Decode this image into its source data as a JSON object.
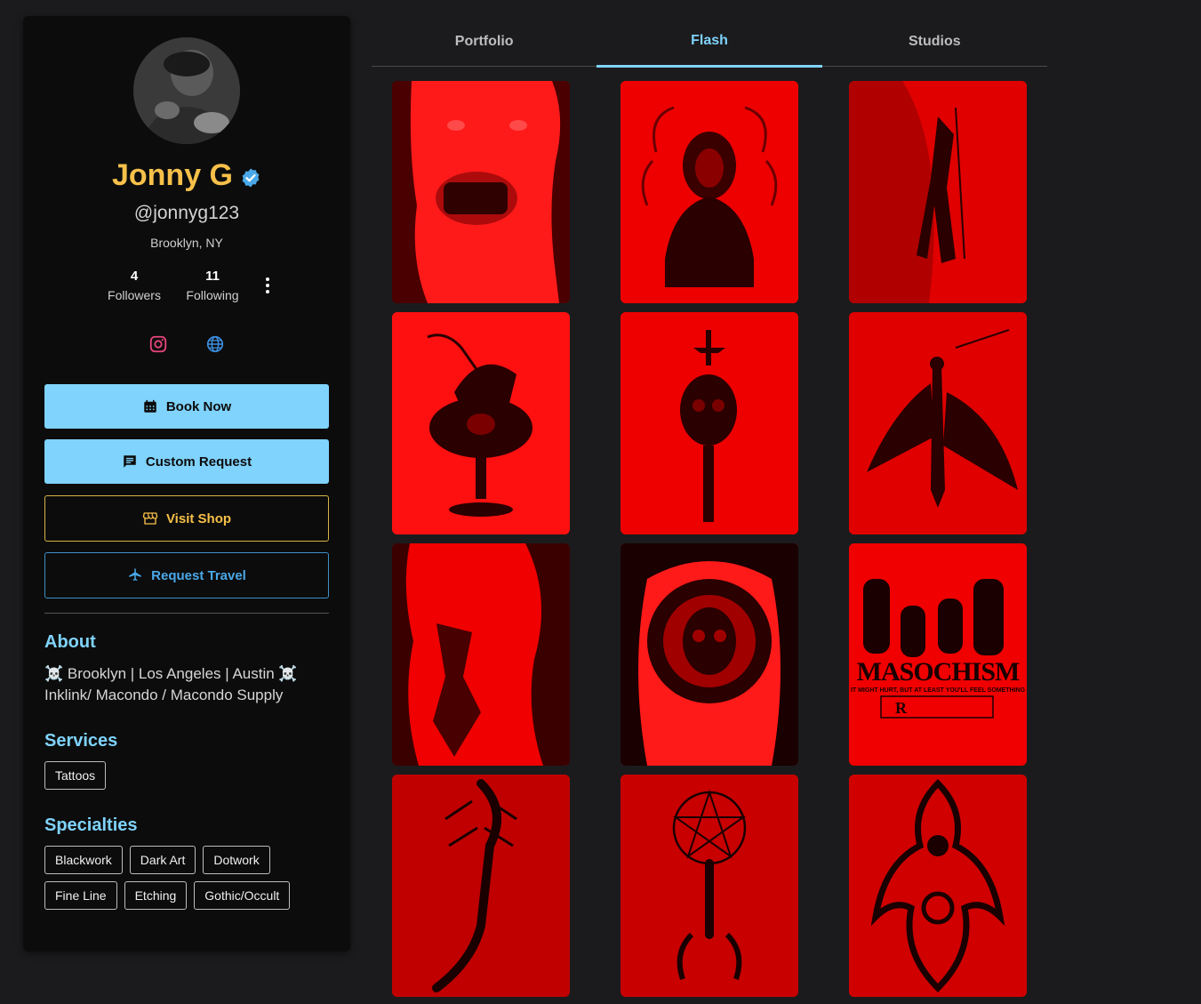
{
  "profile": {
    "name": "Jonny G",
    "handle": "@jonnyg123",
    "location": "Brooklyn, NY",
    "verified": true,
    "followers_count": "4",
    "followers_label": "Followers",
    "following_count": "11",
    "following_label": "Following"
  },
  "socials": {
    "instagram_icon": "instagram-icon",
    "website_icon": "globe-icon"
  },
  "actions": {
    "book_now": "Book Now",
    "custom_request": "Custom Request",
    "visit_shop": "Visit Shop",
    "request_travel": "Request Travel"
  },
  "about": {
    "title": "About",
    "text": "☠️ Brooklyn | Los Angeles | Austin ☠️ Inklink/ Macondo / Macondo Supply"
  },
  "services": {
    "title": "Services",
    "items": [
      "Tattoos"
    ]
  },
  "specialties": {
    "title": "Specialties",
    "items": [
      "Blackwork",
      "Dark Art",
      "Dotwork",
      "Fine Line",
      "Etching",
      "Gothic/Occult"
    ]
  },
  "tabs": [
    {
      "label": "Portfolio",
      "active": false
    },
    {
      "label": "Flash",
      "active": true
    },
    {
      "label": "Studios",
      "active": false
    }
  ],
  "gallery": {
    "items": [
      {
        "subject": "torso-crown-of-thorns"
      },
      {
        "subject": "flaming-madonna"
      },
      {
        "subject": "side-reaper"
      },
      {
        "subject": "reaper-horse-chalice"
      },
      {
        "subject": "skull-dagger"
      },
      {
        "subject": "bat-wing-skeleton"
      },
      {
        "subject": "side-horsemen"
      },
      {
        "subject": "spiked-skull-mandala"
      },
      {
        "subject": "masochism-poster",
        "caption": "MASOCHISM",
        "subcaption": "IT MIGHT HURT, BUT AT LEAST YOU'LL FEEL SOMETHING"
      },
      {
        "subject": "scorpion-spine"
      },
      {
        "subject": "pentagram-scorpion"
      },
      {
        "subject": "ornamental-back"
      }
    ]
  },
  "colors": {
    "accent_blue": "#7fd3fc",
    "accent_gold": "#f7c04a",
    "travel_blue": "#4aa8e8",
    "background": "#1b1b1d",
    "sidebar": "#0c0c0c"
  }
}
